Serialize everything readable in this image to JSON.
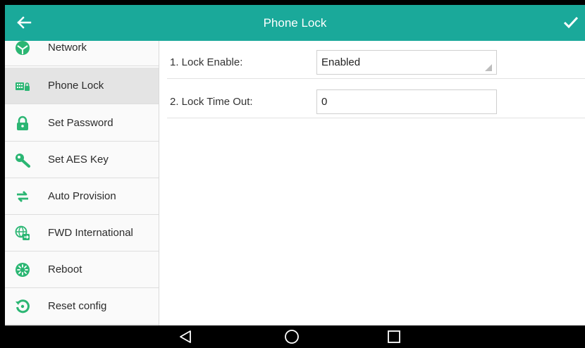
{
  "titlebar": {
    "title": "Phone Lock",
    "back_icon": "arrow-left-icon",
    "confirm_icon": "checkmark-icon"
  },
  "sidebar": {
    "items": [
      {
        "label": "Network",
        "icon": "network-icon",
        "active": false
      },
      {
        "label": "Phone Lock",
        "icon": "phone-lock-icon",
        "active": true
      },
      {
        "label": "Set Password",
        "icon": "padlock-icon",
        "active": false
      },
      {
        "label": "Set AES Key",
        "icon": "key-icon",
        "active": false
      },
      {
        "label": "Auto Provision",
        "icon": "sync-arrows-icon",
        "active": false
      },
      {
        "label": "FWD International",
        "icon": "globe-forward-icon",
        "active": false
      },
      {
        "label": "Reboot",
        "icon": "reboot-icon",
        "active": false
      },
      {
        "label": "Reset config",
        "icon": "reset-icon",
        "active": false
      }
    ]
  },
  "form": {
    "lock_enable": {
      "label": "1. Lock Enable:",
      "value": "Enabled"
    },
    "lock_timeout": {
      "label": "2. Lock Time Out:",
      "value": "0"
    }
  },
  "navbar": {
    "back_icon": "nav-back-triangle-icon",
    "home_icon": "nav-home-circle-icon",
    "recents_icon": "nav-recents-square-icon"
  },
  "colors": {
    "accent": "#1aa99a",
    "icon_green": "#2bb673",
    "active_row": "#e4e4e4"
  }
}
